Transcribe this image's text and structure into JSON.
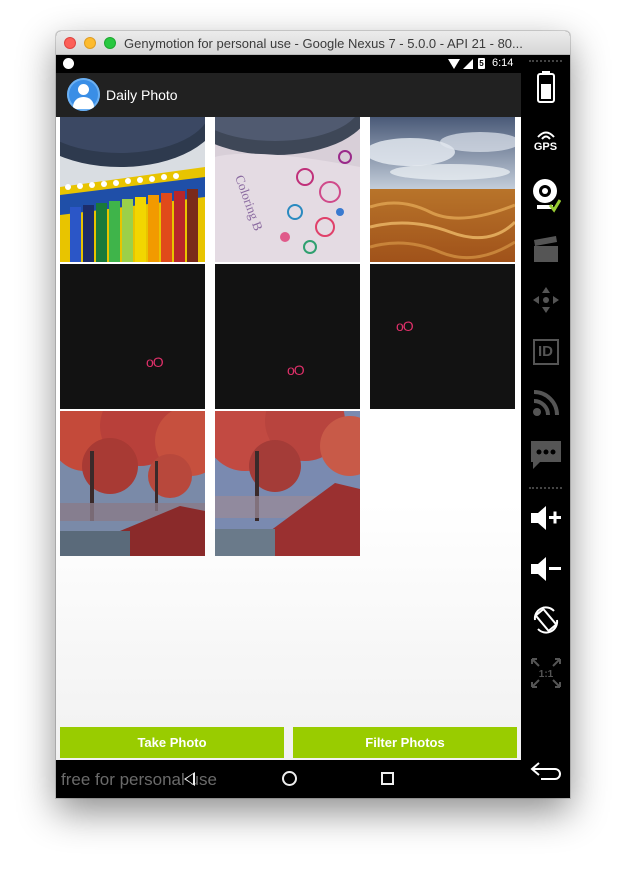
{
  "window": {
    "title": "Genymotion for personal use - Google Nexus 7 - 5.0.0 - API 21 - 80..."
  },
  "status_bar": {
    "time": "6:14",
    "battery_glyph": "5"
  },
  "app_bar": {
    "title": "Daily Photo",
    "icon": "user-avatar-icon"
  },
  "grid": {
    "photos": [
      {
        "name": "photo-colored-pencils",
        "kind": "image"
      },
      {
        "name": "photo-coloring-book",
        "kind": "image"
      },
      {
        "name": "photo-wheat-field",
        "kind": "image"
      },
      {
        "name": "photo-dark-1",
        "kind": "dark"
      },
      {
        "name": "photo-dark-2",
        "kind": "dark"
      },
      {
        "name": "photo-dark-3",
        "kind": "dark"
      },
      {
        "name": "photo-autumn-tree-1",
        "kind": "image"
      },
      {
        "name": "photo-autumn-tree-2",
        "kind": "image"
      }
    ]
  },
  "buttons": {
    "take_photo": "Take Photo",
    "filter_photos": "Filter Photos",
    "color": "#99cc00"
  },
  "nav_bar": {
    "watermark": "free for personal use"
  },
  "sidebar": {
    "gps_label": "GPS",
    "id_label": "ID",
    "ratio_label": "1:1",
    "icons": [
      "battery-icon",
      "gps-icon",
      "webcam-icon",
      "clapper-icon",
      "dpad-icon",
      "id-icon",
      "rss-icon",
      "message-icon",
      "volume-up-icon",
      "volume-down-icon",
      "rotate-icon",
      "scale-icon",
      "back-icon",
      "menu-icon"
    ]
  }
}
